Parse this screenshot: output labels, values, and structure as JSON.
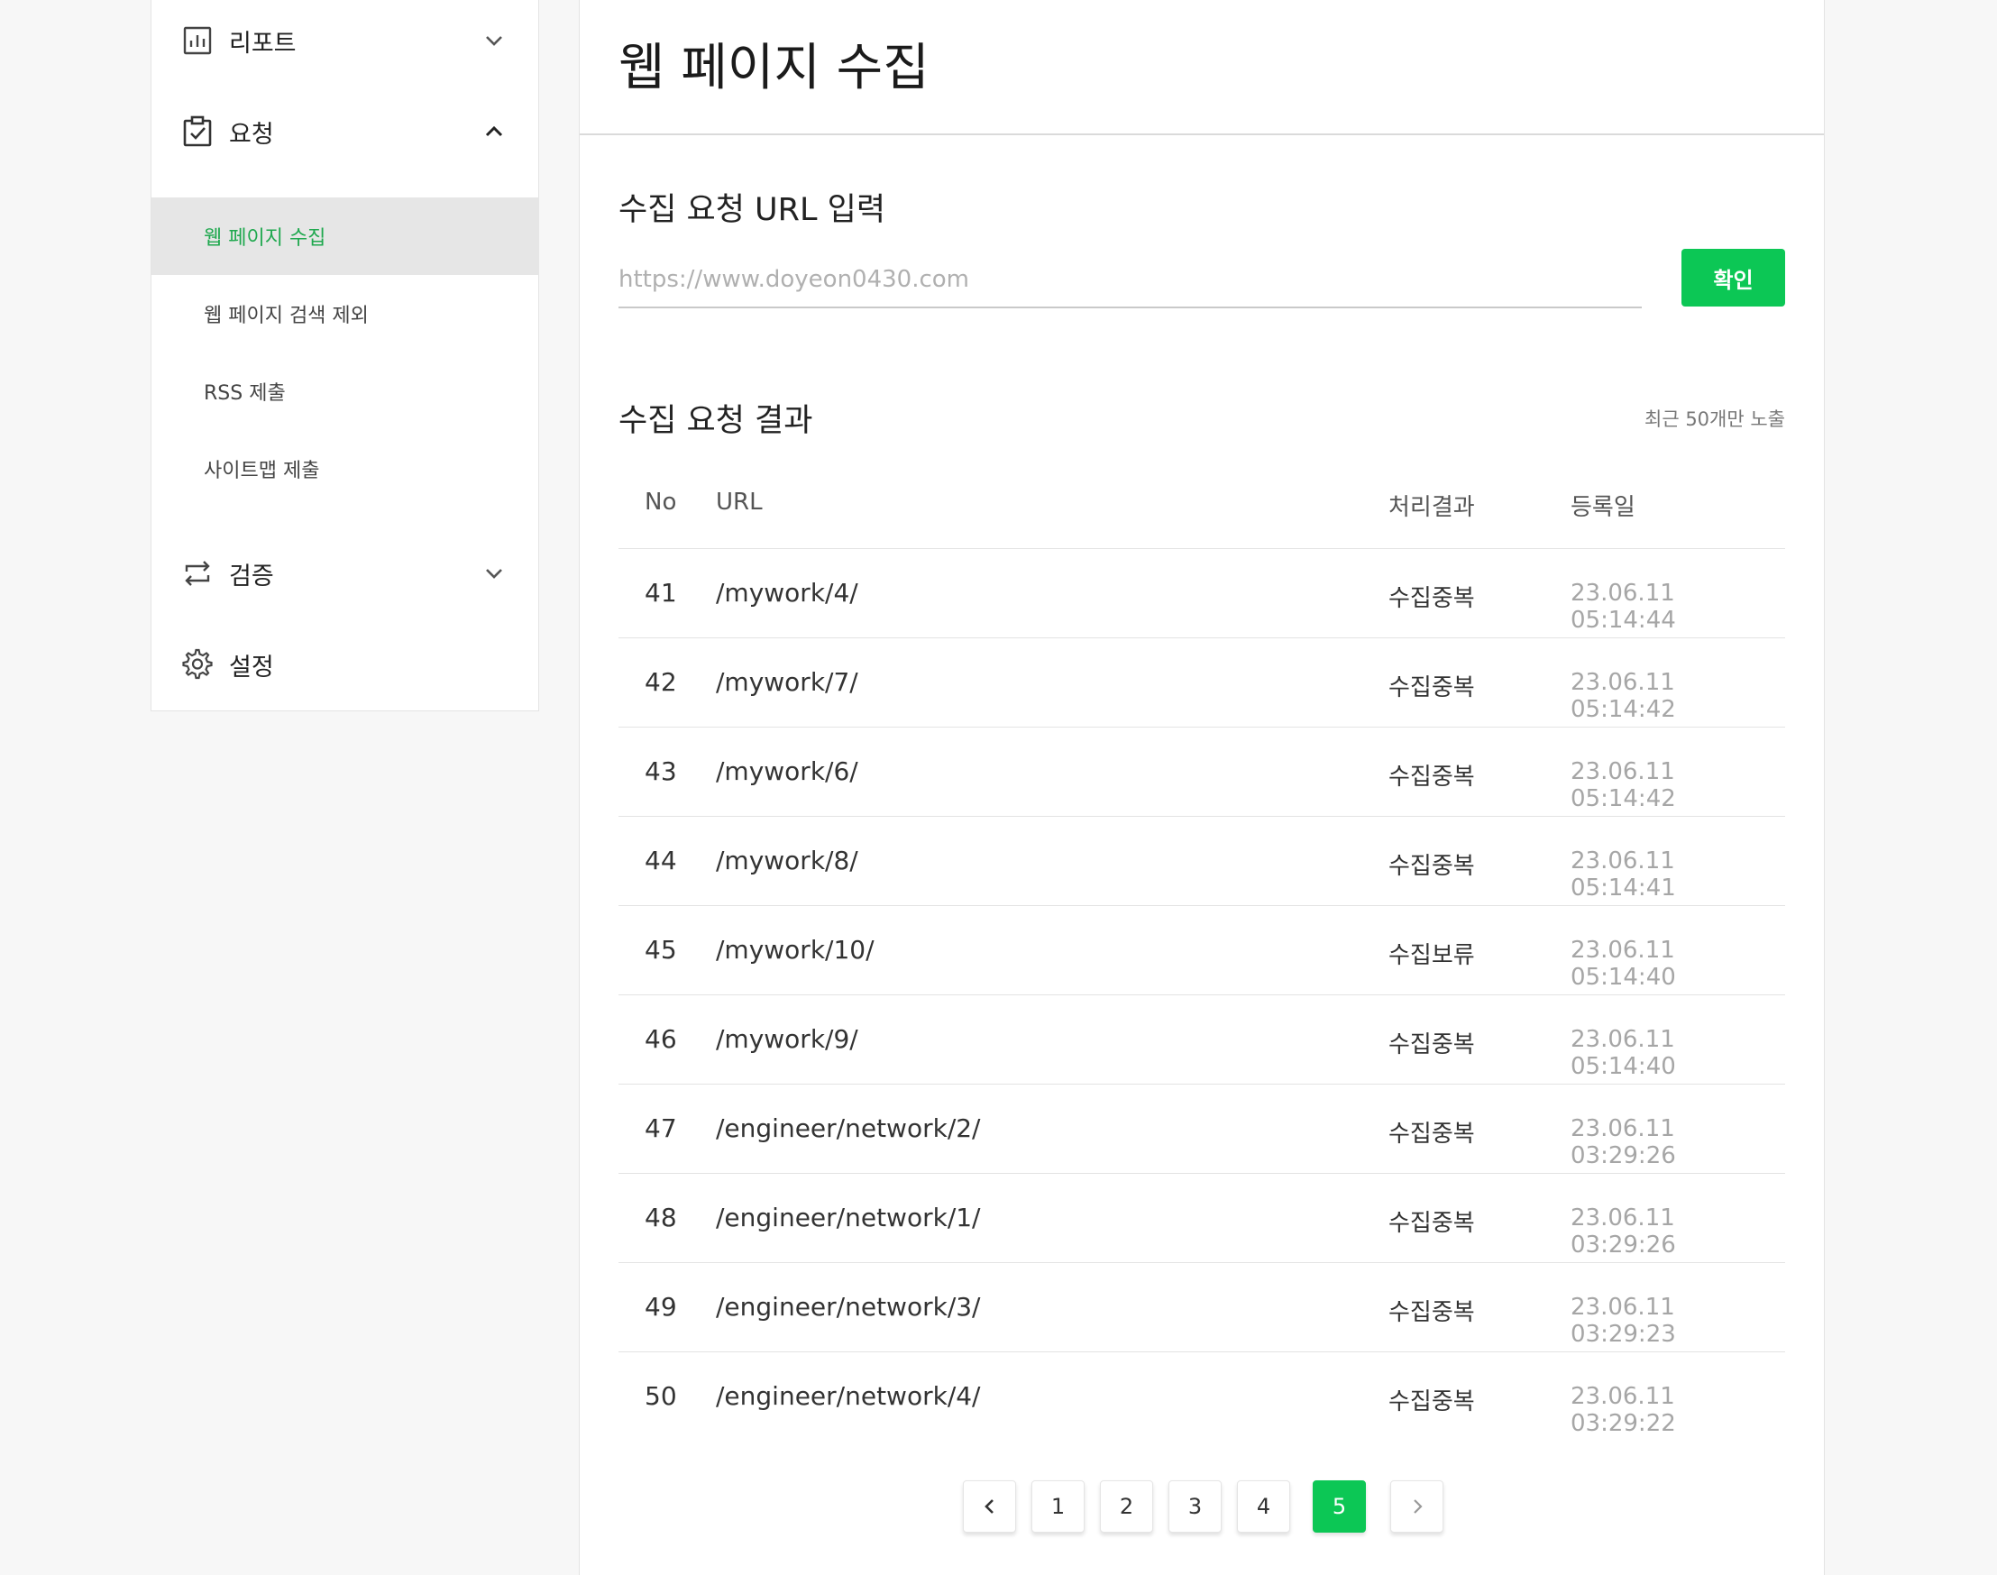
{
  "sidebar": {
    "groups": [
      {
        "label": "리포트",
        "icon": "chart-icon",
        "state": "collapsed"
      },
      {
        "label": "요청",
        "icon": "clipboard-check-icon",
        "state": "expanded"
      },
      {
        "label": "검증",
        "icon": "repeat-icon",
        "state": "collapsed"
      },
      {
        "label": "설정",
        "icon": "gear-icon",
        "state": "none"
      }
    ],
    "subitems": [
      {
        "label": "웹 페이지 수집",
        "active": true
      },
      {
        "label": "웹 페이지 검색 제외",
        "active": false
      },
      {
        "label": "RSS 제출",
        "active": false
      },
      {
        "label": "사이트맵 제출",
        "active": false
      }
    ]
  },
  "main": {
    "title": "웹 페이지 수집",
    "input_section": {
      "title": "수집 요청 URL 입력",
      "placeholder": "https://www.doyeon0430.com",
      "value": "",
      "button": "확인"
    },
    "results_section": {
      "title": "수집 요청 결과",
      "note": "최근 50개만 노출",
      "columns": [
        "No",
        "URL",
        "처리결과",
        "등록일"
      ],
      "rows": [
        {
          "no": "41",
          "url": "/mywork/4/",
          "result": "수집중복",
          "date": "23.06.11 05:14:44"
        },
        {
          "no": "42",
          "url": "/mywork/7/",
          "result": "수집중복",
          "date": "23.06.11 05:14:42"
        },
        {
          "no": "43",
          "url": "/mywork/6/",
          "result": "수집중복",
          "date": "23.06.11 05:14:42"
        },
        {
          "no": "44",
          "url": "/mywork/8/",
          "result": "수집중복",
          "date": "23.06.11 05:14:41"
        },
        {
          "no": "45",
          "url": "/mywork/10/",
          "result": "수집보류",
          "date": "23.06.11 05:14:40"
        },
        {
          "no": "46",
          "url": "/mywork/9/",
          "result": "수집중복",
          "date": "23.06.11 05:14:40"
        },
        {
          "no": "47",
          "url": "/engineer/network/2/",
          "result": "수집중복",
          "date": "23.06.11 03:29:26"
        },
        {
          "no": "48",
          "url": "/engineer/network/1/",
          "result": "수집중복",
          "date": "23.06.11 03:29:26"
        },
        {
          "no": "49",
          "url": "/engineer/network/3/",
          "result": "수집중복",
          "date": "23.06.11 03:29:23"
        },
        {
          "no": "50",
          "url": "/engineer/network/4/",
          "result": "수집중복",
          "date": "23.06.11 03:29:22"
        }
      ]
    },
    "pagination": {
      "pages": [
        "1",
        "2",
        "3",
        "4",
        "5"
      ],
      "current": "5"
    }
  },
  "colors": {
    "accent": "#0cc755",
    "active_text": "#1fa84e",
    "active_bg": "#e6e6e6",
    "date_text": "#a6a6a6"
  }
}
